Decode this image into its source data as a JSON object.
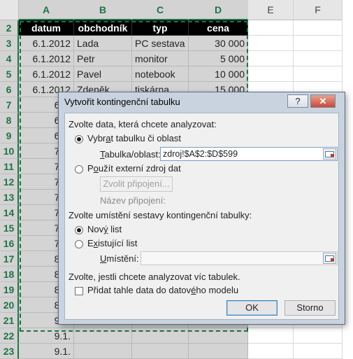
{
  "sheet": {
    "columns": [
      "A",
      "B",
      "C",
      "D",
      "E",
      "F"
    ],
    "rows": [
      "2",
      "3",
      "4",
      "5",
      "6",
      "7",
      "8",
      "9",
      "10",
      "11",
      "12",
      "13",
      "14",
      "15",
      "16",
      "17",
      "18",
      "19",
      "20",
      "21",
      "22",
      "23"
    ],
    "header": [
      "datum",
      "obchodník",
      "typ",
      "cena"
    ],
    "data": [
      [
        "6.1.2012",
        "Lada",
        "PC sestava",
        "30 000"
      ],
      [
        "6.1.2012",
        "Petr",
        "monitor",
        "5 000"
      ],
      [
        "6.1.2012",
        "Pavel",
        "notebook",
        "10 000"
      ],
      [
        "6.1.2012",
        "Zdeněk",
        "tiskárna",
        "15 000"
      ],
      [
        "6.1.",
        "",
        "",
        ""
      ],
      [
        "6.1.",
        "",
        "",
        ""
      ],
      [
        "6.1.",
        "",
        "",
        ""
      ],
      [
        "7.1.",
        "",
        "",
        ""
      ],
      [
        "7.1.",
        "",
        "",
        ""
      ],
      [
        "7.1.",
        "",
        "",
        ""
      ],
      [
        "7.1.",
        "",
        "",
        ""
      ],
      [
        "7.1.",
        "",
        "",
        ""
      ],
      [
        "7.1.",
        "",
        "",
        ""
      ],
      [
        "7.1.",
        "",
        "",
        ""
      ],
      [
        "8.1.",
        "",
        "",
        ""
      ],
      [
        "8.1.",
        "",
        "",
        ""
      ],
      [
        "8.1.",
        "",
        "",
        ""
      ],
      [
        "8.1.",
        "",
        "",
        ""
      ],
      [
        "9.1.",
        "",
        "",
        ""
      ],
      [
        "9.1.",
        "",
        "",
        ""
      ],
      [
        "9.1.",
        "",
        "",
        ""
      ]
    ]
  },
  "dialog": {
    "title": "Vytvořit kontingenční tabulku",
    "help_label": "?",
    "close_label": "✕",
    "section1": "Zvolte data, která chcete analyzovat:",
    "opt_select_pre": "Vybr",
    "opt_select_u": "a",
    "opt_select_post": "t tabulku či oblast",
    "table_label_pre": "",
    "table_label_u": "T",
    "table_label_post": "abulka/oblast:",
    "table_value": "zdroj!$A$2:$D$599",
    "opt_external_pre": "P",
    "opt_external_u": "o",
    "opt_external_post": "užít externí zdroj dat",
    "choose_connection": "Zvolit připojení...",
    "connection_name": "Název připojení:",
    "section2": "Zvolte umístění sestavy kontingenční tabulky:",
    "opt_new_pre": "Nov",
    "opt_new_u": "ý",
    "opt_new_post": " list",
    "opt_existing_pre": "E",
    "opt_existing_u": "x",
    "opt_existing_post": "istující list",
    "location_label_pre": "",
    "location_label_u": "U",
    "location_label_post": "místění:",
    "location_value": "",
    "section3": "Zvolte, jestli chcete analyzovat víc tabulek.",
    "add_model_pre": "Přidat tahle data do datov",
    "add_model_u": "é",
    "add_model_post": "ho modelu",
    "ok": "OK",
    "cancel": "Storno"
  },
  "colors": {
    "accent": "#217346",
    "dialog_frame": "#c9d3df",
    "selected_cells": "#d4d4d4"
  }
}
